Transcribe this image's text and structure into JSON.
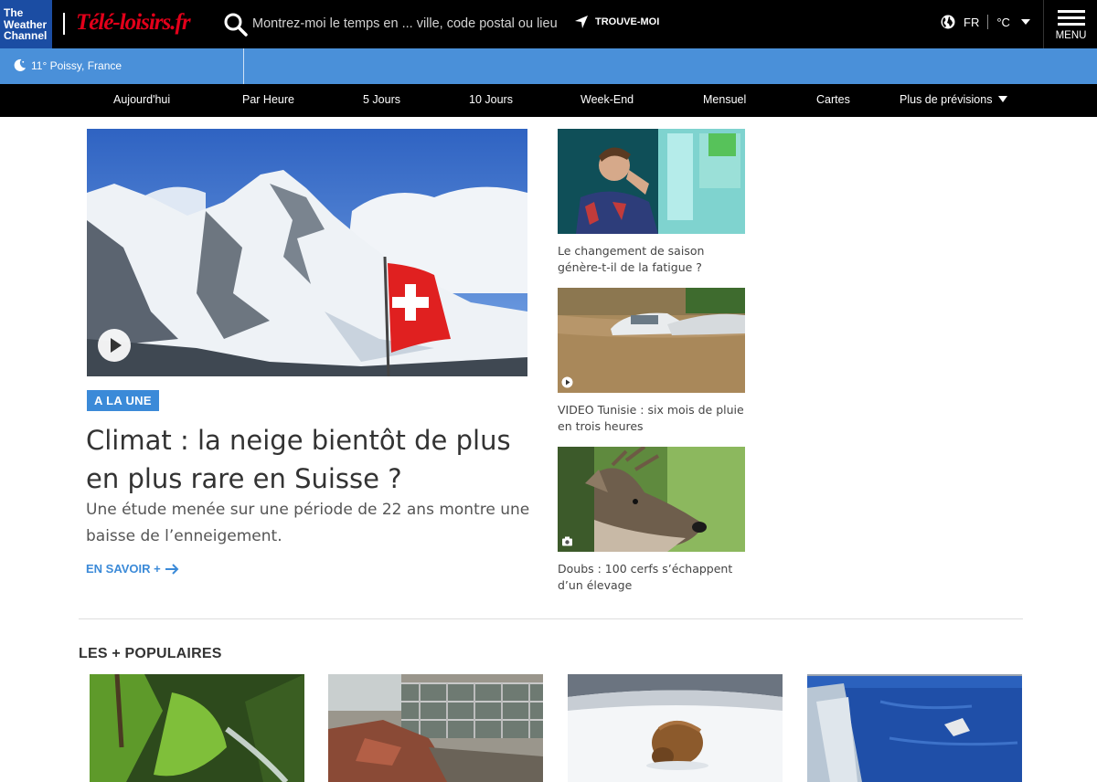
{
  "header": {
    "twc_logo": [
      "The",
      "Weather",
      "Channel"
    ],
    "brand_logo": "Télé-loisirs.fr",
    "search_placeholder": "Montrez-moi le temps en ... ville, code postal ou lieu",
    "locate_label": "TROUVE-MOI",
    "language": "FR",
    "unit": "°C",
    "menu_label": "MENU"
  },
  "location": {
    "text": "11° Poissy, France"
  },
  "nav": [
    {
      "label": "Aujourd'hui"
    },
    {
      "label": "Par Heure"
    },
    {
      "label": "5 Jours"
    },
    {
      "label": "10 Jours"
    },
    {
      "label": "Week-End"
    },
    {
      "label": "Mensuel"
    },
    {
      "label": "Cartes"
    },
    {
      "label": "Plus de prévisions"
    }
  ],
  "hero": {
    "badge": "A LA UNE",
    "title": "Climat : la neige bientôt de plus en plus rare en Suisse ?",
    "subtitle": "Une étude menée sur une période de 22 ans montre une baisse de l’enneigement.",
    "more_label": "EN SAVOIR +"
  },
  "side_articles": [
    {
      "caption": "Le changement de saison génère-t-il de la fatigue ?",
      "media": "none"
    },
    {
      "caption": "VIDEO Tunisie : six mois de pluie en trois heures",
      "media": "play-icon"
    },
    {
      "caption": "Doubs : 100 cerfs s’échappent d’un élevage",
      "media": "camera-icon"
    }
  ],
  "popular": {
    "title": "LES + POPULAIRES"
  },
  "colors": {
    "blue_bar": "#4a90d9",
    "accent": "#3b8ad8",
    "twc_blue": "#1b4da3",
    "brand_red": "#e2001a"
  }
}
